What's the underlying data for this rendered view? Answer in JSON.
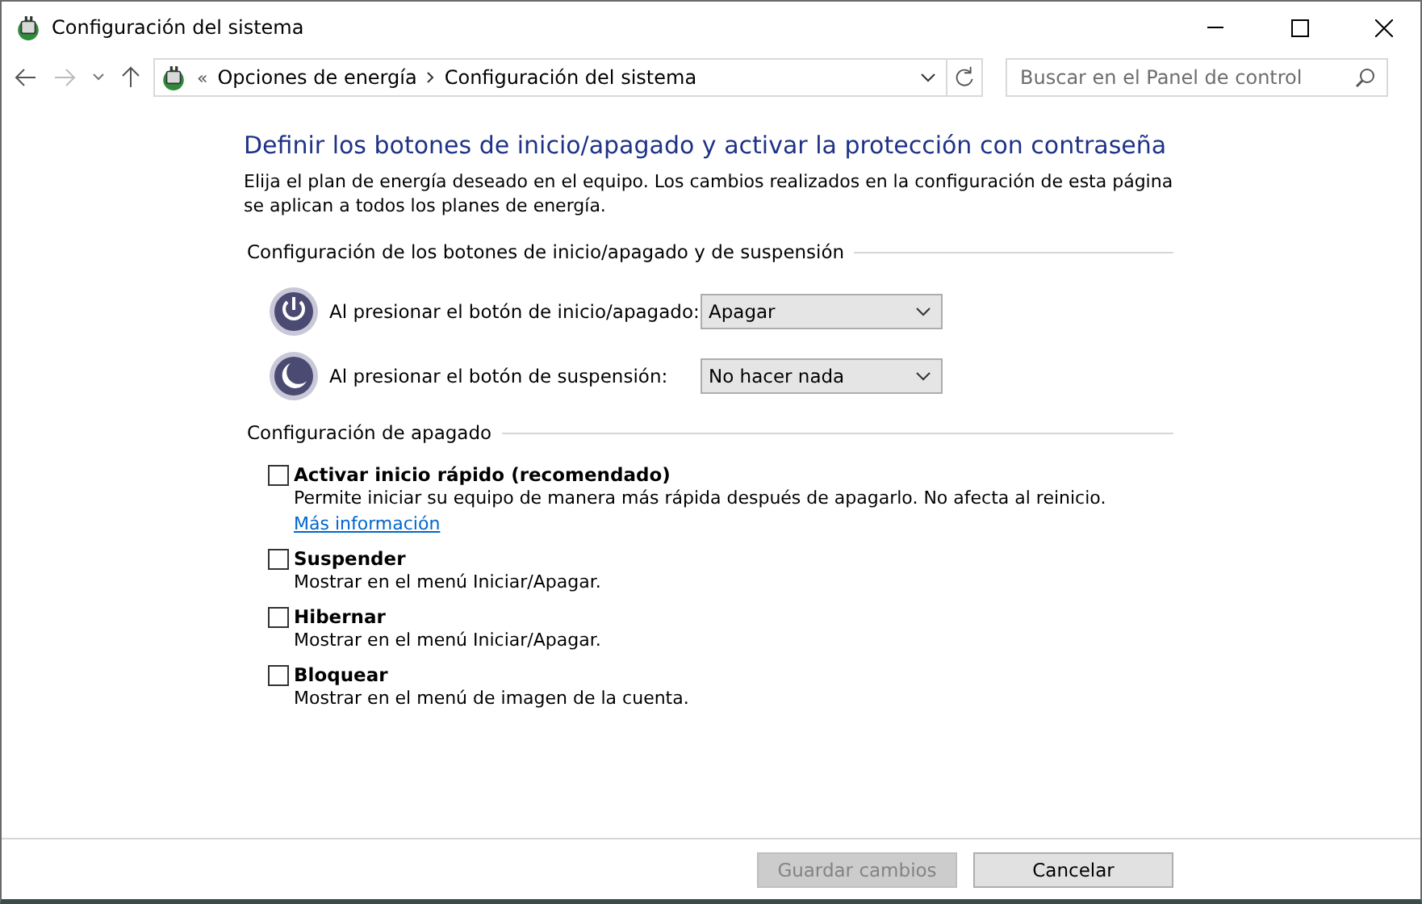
{
  "window": {
    "title": "Configuración del sistema"
  },
  "address_bar": {
    "breadcrumbs": [
      "Opciones de energía",
      "Configuración del sistema"
    ],
    "overflow": "«"
  },
  "search": {
    "placeholder": "Buscar en el Panel de control"
  },
  "heading": "Definir los botones de inicio/apagado y activar la protección con contraseña",
  "intro": "Elija el plan de energía deseado en el equipo. Los cambios realizados en la configuración de esta página se aplican a todos los planes de energía.",
  "button_settings": {
    "title": "Configuración de los botones de inicio/apagado y de suspensión",
    "rows": [
      {
        "kind": "power",
        "label": "Al presionar el botón de inicio/apagado:",
        "value": "Apagar"
      },
      {
        "kind": "sleep",
        "label": "Al presionar el botón de suspensión:",
        "value": "No hacer nada"
      }
    ]
  },
  "shutdown_settings": {
    "title": "Configuración de apagado",
    "options": [
      {
        "label": "Activar inicio rápido (recomendado)",
        "checked": false,
        "description": "Permite iniciar su equipo de manera más rápida después de apagarlo. No afecta al reinicio.",
        "link": "Más información"
      },
      {
        "label": "Suspender",
        "checked": false,
        "description": "Mostrar en el menú Iniciar/Apagar."
      },
      {
        "label": "Hibernar",
        "checked": false,
        "description": "Mostrar en el menú Iniciar/Apagar."
      },
      {
        "label": "Bloquear",
        "checked": false,
        "description": "Mostrar en el menú de imagen de la cuenta."
      }
    ]
  },
  "buttons": [
    {
      "label": "Guardar cambios",
      "disabled": true
    },
    {
      "label": "Cancelar",
      "disabled": false
    }
  ]
}
